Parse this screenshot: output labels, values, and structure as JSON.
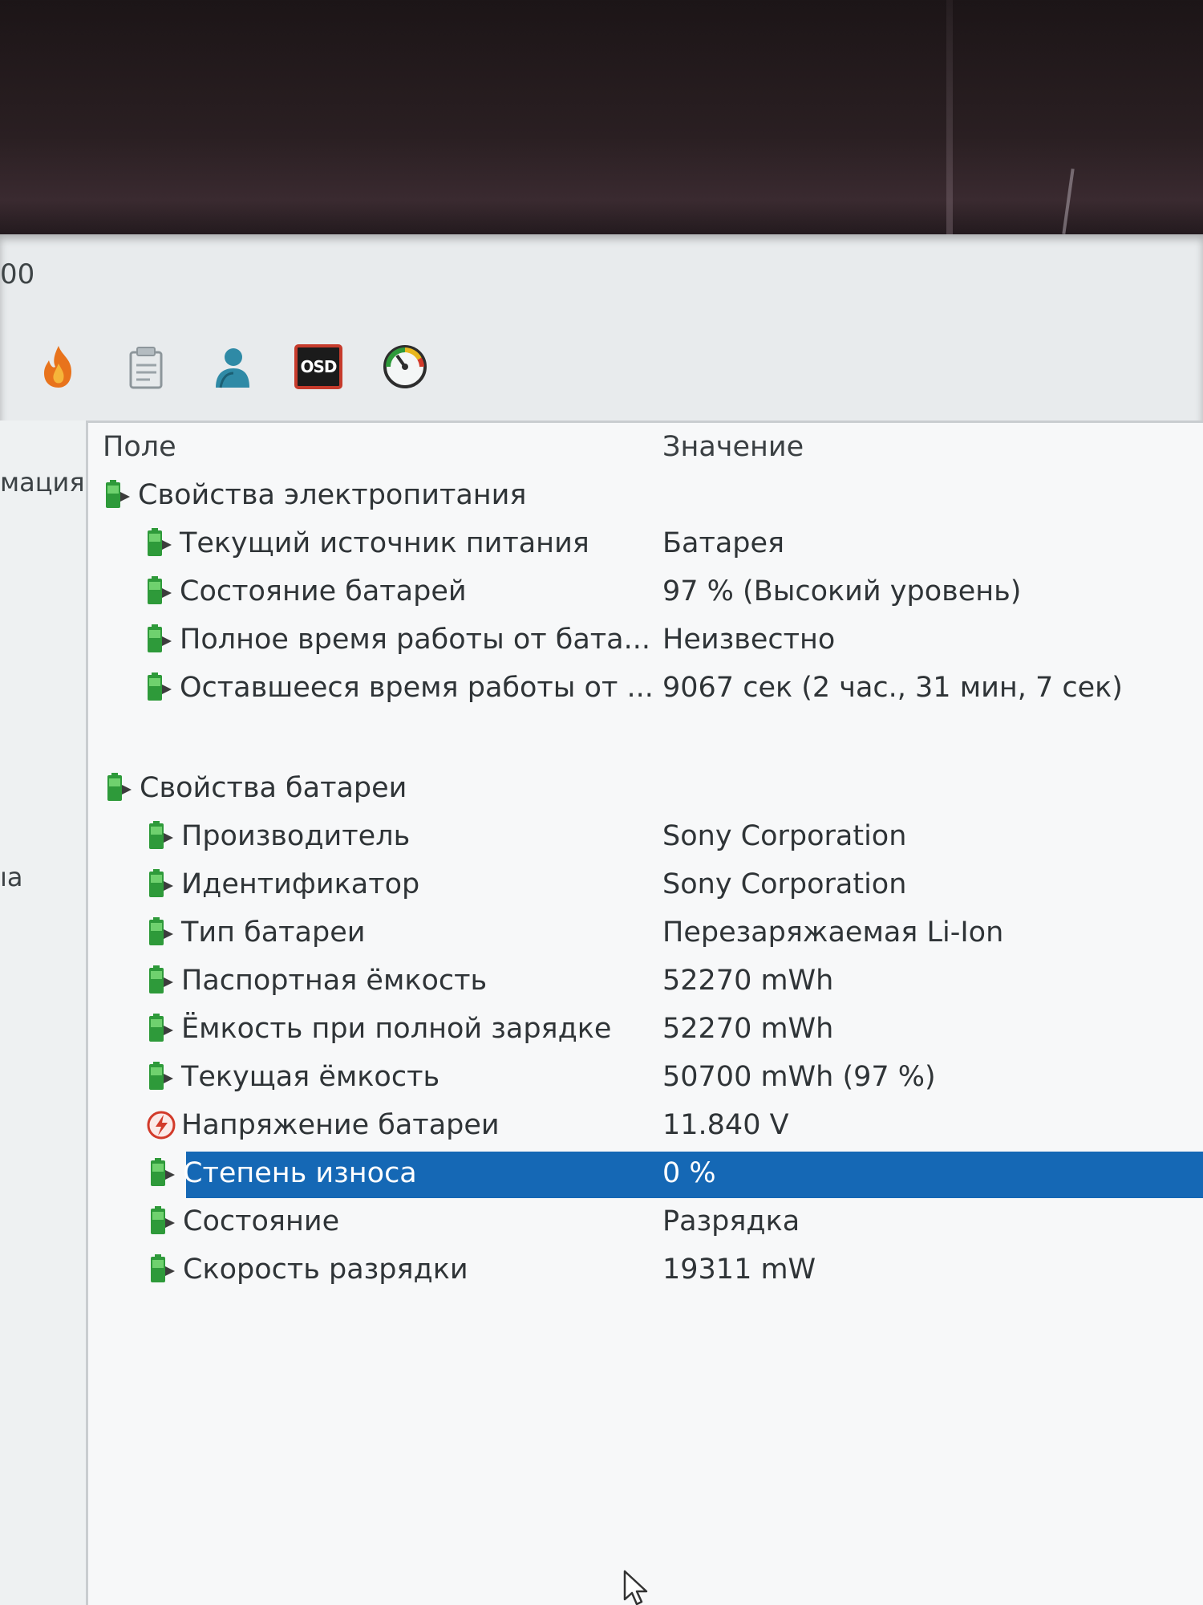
{
  "window": {
    "title_fragment": "00"
  },
  "toolbar": {
    "buttons": [
      {
        "name": "flame-icon"
      },
      {
        "name": "report-icon"
      },
      {
        "name": "user-icon"
      },
      {
        "name": "osd-icon",
        "label": "OSD"
      },
      {
        "name": "gauge-icon"
      }
    ]
  },
  "sidebar": {
    "items": [
      "мация",
      "ıa"
    ]
  },
  "table": {
    "headers": {
      "field": "Поле",
      "value": "Значение"
    },
    "groups": [
      {
        "title": "Свойства электропитания",
        "rows": [
          {
            "field": "Текущий источник питания",
            "value": "Батарея"
          },
          {
            "field": "Состояние батарей",
            "value": "97 % (Высокий уровень)"
          },
          {
            "field": "Полное время работы от бата...",
            "value": "Неизвестно"
          },
          {
            "field": "Оставшееся время работы от ...",
            "value": "9067 сек (2 час., 31 мин, 7 сек)"
          }
        ]
      },
      {
        "title": "Свойства батареи",
        "rows": [
          {
            "field": "Производитель",
            "value": "Sony Corporation"
          },
          {
            "field": "Идентификатор",
            "value": "Sony Corporation"
          },
          {
            "field": "Тип батареи",
            "value": "Перезаряжаемая Li-Ion"
          },
          {
            "field": "Паспортная ёмкость",
            "value": "52270 mWh"
          },
          {
            "field": "Ёмкость при полной зарядке",
            "value": "52270 mWh"
          },
          {
            "field": "Текущая ёмкость",
            "value": "50700 mWh  (97 %)"
          },
          {
            "field": "Напряжение батареи",
            "value": "11.840 V",
            "icon": "voltage-icon"
          },
          {
            "field": "Степень износа",
            "value": "0 %",
            "selected": true
          },
          {
            "field": "Состояние",
            "value": "Разрядка"
          },
          {
            "field": "Скорость разрядки",
            "value": "19311 mW"
          }
        ]
      }
    ]
  },
  "colors": {
    "selection": "#1568b5",
    "battery_icon": "#2e9a3a",
    "voltage_icon": "#d23a2a"
  }
}
